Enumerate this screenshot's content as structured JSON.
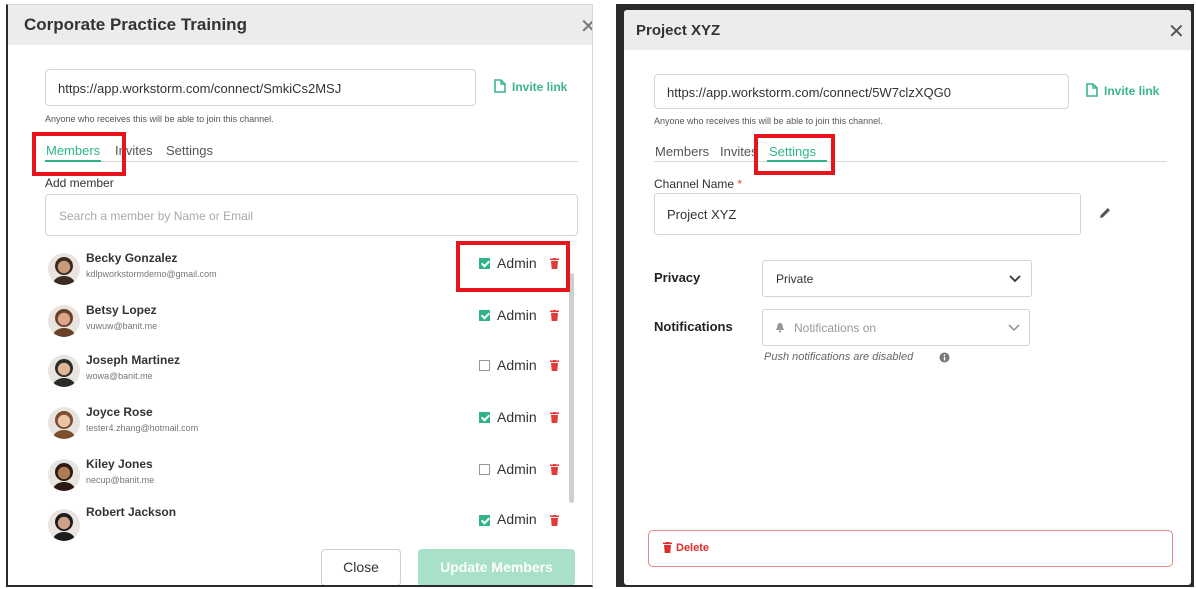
{
  "left_dialog": {
    "title": "Corporate Practice Training",
    "url": "https://app.workstorm.com/connect/SmkiCs2MSJ",
    "invite_link_label": "Invite link",
    "hint": "Anyone who receives this will be able to join this channel.",
    "tabs": [
      "Members",
      "Invites",
      "Settings"
    ],
    "active_tab": "Members",
    "add_member_label": "Add member",
    "search_placeholder": "Search a member by Name or Email",
    "admin_label": "Admin",
    "members": [
      {
        "name": "Becky Gonzalez",
        "email": "kdlpworkstormdemo@gmail.com",
        "admin": true
      },
      {
        "name": "Betsy Lopez",
        "email": "vuwuw@banit.me",
        "admin": true
      },
      {
        "name": "Joseph Martinez",
        "email": "wowa@banit.me",
        "admin": false
      },
      {
        "name": "Joyce Rose",
        "email": "tester4.zhang@hotmail.com",
        "admin": true
      },
      {
        "name": "Kiley Jones",
        "email": "necup@banit.me",
        "admin": false
      },
      {
        "name": "Robert Jackson",
        "email": "",
        "admin": true
      }
    ],
    "close_label": "Close",
    "update_label": "Update Members"
  },
  "right_dialog": {
    "title": "Project XYZ",
    "url": "https://app.workstorm.com/connect/5W7clzXQG0",
    "invite_link_label": "Invite link",
    "hint": "Anyone who receives this will be able to join this channel.",
    "tabs": [
      "Members",
      "Invites",
      "Settings"
    ],
    "active_tab": "Settings",
    "channel_name_label": "Channel Name",
    "required_mark": "*",
    "channel_name_value": "Project XYZ",
    "privacy_label": "Privacy",
    "privacy_value": "Private",
    "notifications_label": "Notifications",
    "notifications_value": "Notifications on",
    "push_note": "Push notifications are disabled",
    "delete_label": "Delete"
  },
  "colors": {
    "accent": "#2fb38b",
    "highlight": "#e8141b",
    "danger": "#e02c2c"
  },
  "icons": [
    "close-icon",
    "document-icon",
    "checkbox-icon",
    "trash-icon",
    "pencil-icon",
    "chevron-down-icon",
    "bell-icon",
    "info-icon"
  ]
}
